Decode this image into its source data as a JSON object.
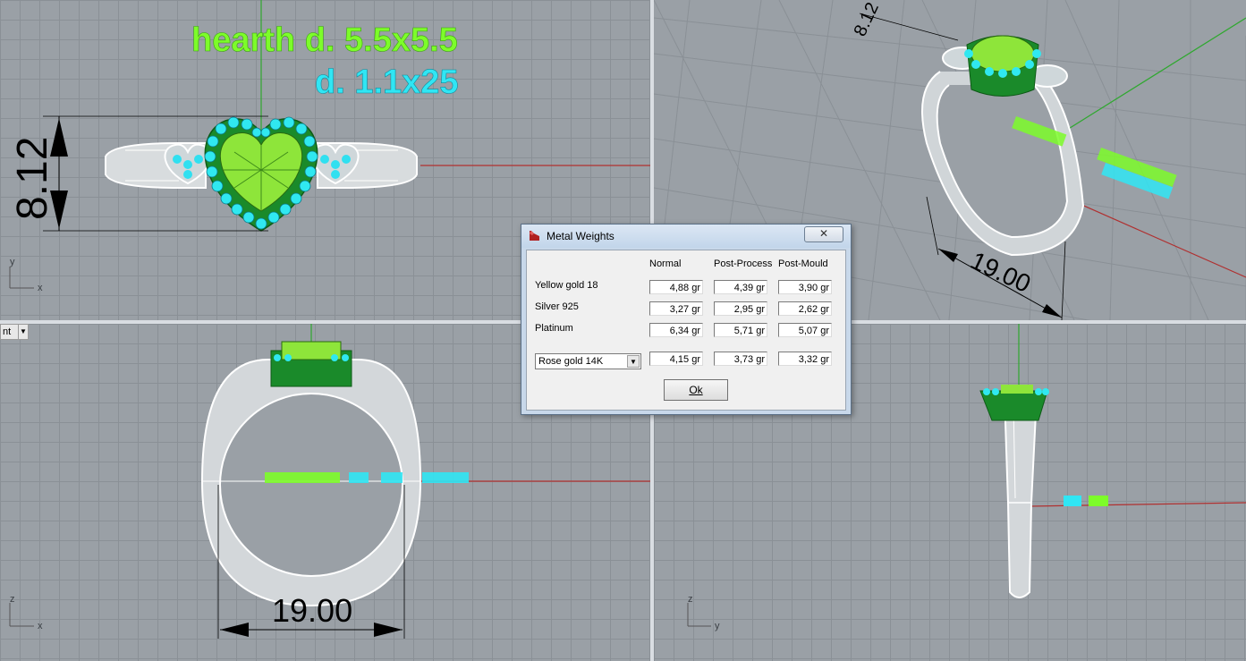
{
  "viewport_top": {
    "annotation_green": "hearth d. 5.5x5.5",
    "annotation_cyan": "d. 1.1x25",
    "dimension": "8.12",
    "axis_x": "x",
    "axis_y": "y"
  },
  "viewport_perspective": {
    "dimension_top": "8.12",
    "dimension_bottom": "19.00"
  },
  "viewport_front": {
    "label": "nt",
    "dimension": "19.00",
    "axis_x": "x",
    "axis_z": "z"
  },
  "viewport_right": {
    "axis_y": "y",
    "axis_z": "z"
  },
  "dialog": {
    "title": "Metal Weights",
    "close_label": "✕",
    "headers": [
      "Normal",
      "Post-Process",
      "Post-Mould"
    ],
    "rows": [
      {
        "label": "Yellow gold 18",
        "normal": "4,88 gr",
        "post_process": "4,39 gr",
        "post_mould": "3,90 gr"
      },
      {
        "label": "Silver 925",
        "normal": "3,27 gr",
        "post_process": "2,95 gr",
        "post_mould": "2,62 gr"
      },
      {
        "label": "Platinum",
        "normal": "6,34 gr",
        "post_process": "5,71 gr",
        "post_mould": "5,07 gr"
      }
    ],
    "selected_metal": {
      "label": "Rose gold 14K",
      "normal": "4,15 gr",
      "post_process": "3,73 gr",
      "post_mould": "3,32 gr"
    },
    "ok_label": "Ok"
  }
}
